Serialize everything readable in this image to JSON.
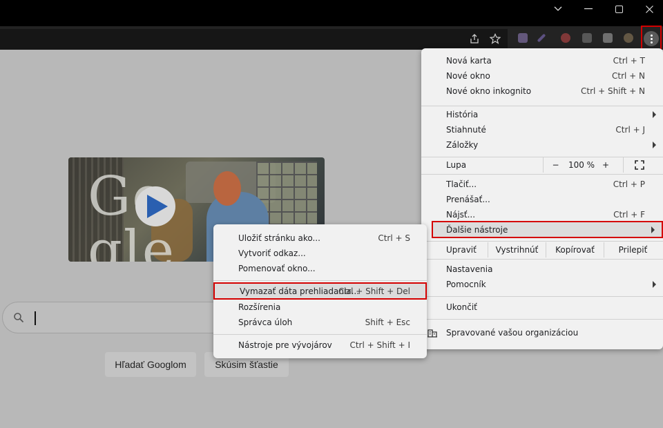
{
  "window_controls": {
    "minimize_icon": "chevron-down-icon",
    "restore_icon": "maximize-icon",
    "close_icon": "close-icon"
  },
  "toolbar": {
    "share_icon": "share-icon",
    "bookmark_icon": "star-icon",
    "menu_icon": "kebab-menu-icon"
  },
  "page": {
    "search_placeholder": "",
    "search_button": "Hľadať Googlom",
    "lucky_button": "Skúsim šťastie",
    "doodle_text_left": "Go",
    "doodle_text_right": "gle"
  },
  "chrome_menu": {
    "new_tab": {
      "label": "Nová karta",
      "shortcut": "Ctrl + T"
    },
    "new_window": {
      "label": "Nové okno",
      "shortcut": "Ctrl + N"
    },
    "incognito": {
      "label": "Nové okno inkognito",
      "shortcut": "Ctrl + Shift + N"
    },
    "history": {
      "label": "História"
    },
    "downloads": {
      "label": "Stiahnuté",
      "shortcut": "Ctrl + J"
    },
    "bookmarks": {
      "label": "Záložky"
    },
    "zoom": {
      "label": "Lupa",
      "minus": "−",
      "value": "100 %",
      "plus": "+"
    },
    "print": {
      "label": "Tlačiť...",
      "shortcut": "Ctrl + P"
    },
    "cast": {
      "label": "Prenášať..."
    },
    "find": {
      "label": "Nájsť...",
      "shortcut": "Ctrl + F"
    },
    "more_tools": {
      "label": "Ďalšie nástroje"
    },
    "edit": {
      "label": "Upraviť",
      "cut": "Vystrihnúť",
      "copy": "Kopírovať",
      "paste": "Prilepiť"
    },
    "settings": {
      "label": "Nastavenia"
    },
    "help": {
      "label": "Pomocník"
    },
    "exit": {
      "label": "Ukončiť"
    },
    "managed": {
      "label": "Spravované vašou organizáciou"
    }
  },
  "more_tools_menu": {
    "save_page": {
      "label": "Uložiť stránku ako...",
      "shortcut": "Ctrl + S"
    },
    "create_shortcut": {
      "label": "Vytvoriť odkaz..."
    },
    "name_window": {
      "label": "Pomenovať okno..."
    },
    "clear_data": {
      "label": "Vymazať dáta prehliadania...",
      "shortcut": "Ctrl + Shift + Del"
    },
    "extensions": {
      "label": "Rozšírenia"
    },
    "task_manager": {
      "label": "Správca úloh",
      "shortcut": "Shift + Esc"
    },
    "dev_tools": {
      "label": "Nástroje pre vývojárov",
      "shortcut": "Ctrl + Shift + I"
    }
  },
  "colors": {
    "highlight_border": "#d40000",
    "menu_bg": "#f1f1f1",
    "page_dim": "#b8b8b8"
  }
}
